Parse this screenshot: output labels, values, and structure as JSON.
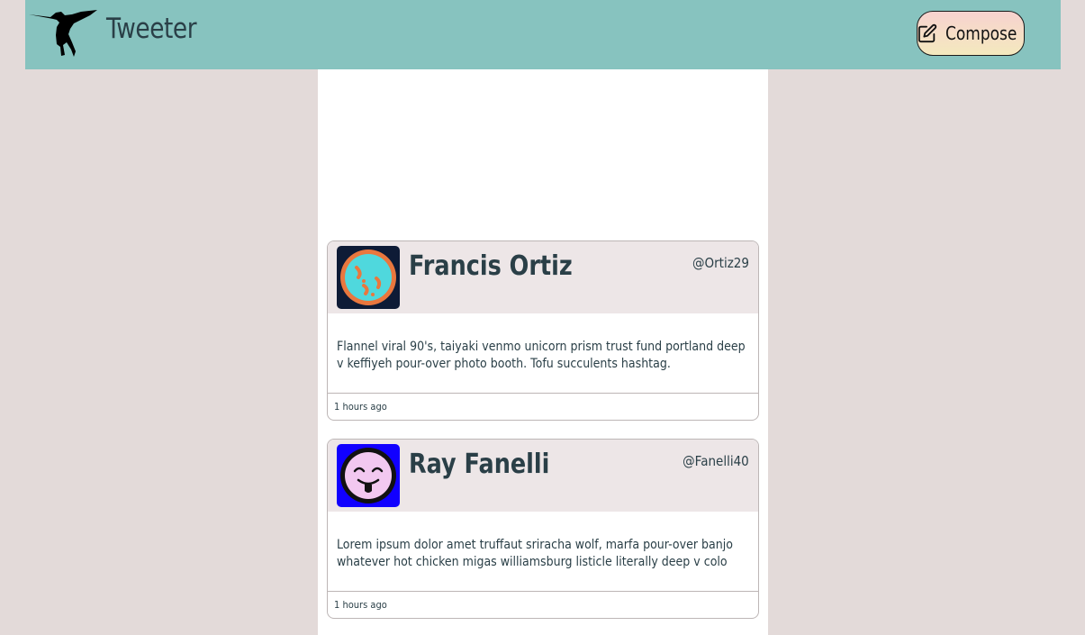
{
  "nav": {
    "brand": "Tweeter",
    "logo_icon": "hummingbird-icon",
    "compose_label": "Compose",
    "compose_icon": "edit-icon"
  },
  "colors": {
    "page_bg": "#e3dad9",
    "nav_bg": "#87c3bf",
    "text": "#2a3f47",
    "tweet_header_bg": "#ede6e7"
  },
  "tweets": [
    {
      "name": "Francis Ortiz",
      "handle": "@Ortiz29",
      "content": "Flannel viral 90's, taiyaki venmo unicorn prism trust fund portland deep v keffiyeh pour-over photo booth. Tofu succulents hashtag.",
      "time": "1 hours ago",
      "avatar_icon": "pizza-face-avatar"
    },
    {
      "name": "Ray Fanelli",
      "handle": "@Fanelli40",
      "content": "Lorem ipsum dolor amet truffaut sriracha wolf, marfa pour-over banjo whatever hot chicken migas williamsburg listicle literally deep v colo",
      "time": "1 hours ago",
      "avatar_icon": "tongue-out-face-avatar"
    }
  ]
}
